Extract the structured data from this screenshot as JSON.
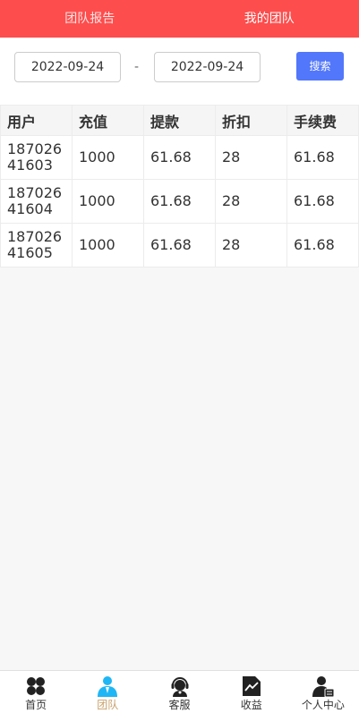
{
  "header": {
    "tabs": [
      {
        "label": "团队报告"
      },
      {
        "label": "我的团队"
      }
    ]
  },
  "filter": {
    "start_date": "2022-09-24",
    "separator": "-",
    "end_date": "2022-09-24",
    "search_label": "搜索"
  },
  "table": {
    "columns": [
      "用户",
      "充值",
      "提款",
      "折扣",
      "手续费"
    ],
    "rows": [
      [
        "18702641603",
        "1000",
        "61.68",
        "28",
        "61.68"
      ],
      [
        "18702641604",
        "1000",
        "61.68",
        "28",
        "61.68"
      ],
      [
        "18702641605",
        "1000",
        "61.68",
        "28",
        "61.68"
      ]
    ]
  },
  "tabbar": {
    "items": [
      {
        "label": "首页",
        "icon": "home-clover-icon"
      },
      {
        "label": "团队",
        "icon": "team-icon"
      },
      {
        "label": "客服",
        "icon": "customer-service-icon"
      },
      {
        "label": "收益",
        "icon": "earnings-chart-icon"
      },
      {
        "label": "个人中心",
        "icon": "user-profile-icon"
      }
    ]
  },
  "colors": {
    "header_bg": "#fd4d4d",
    "search_button": "#5277fa",
    "active_tab_label": "#c8a06a",
    "team_icon": "#1fb6f5"
  }
}
